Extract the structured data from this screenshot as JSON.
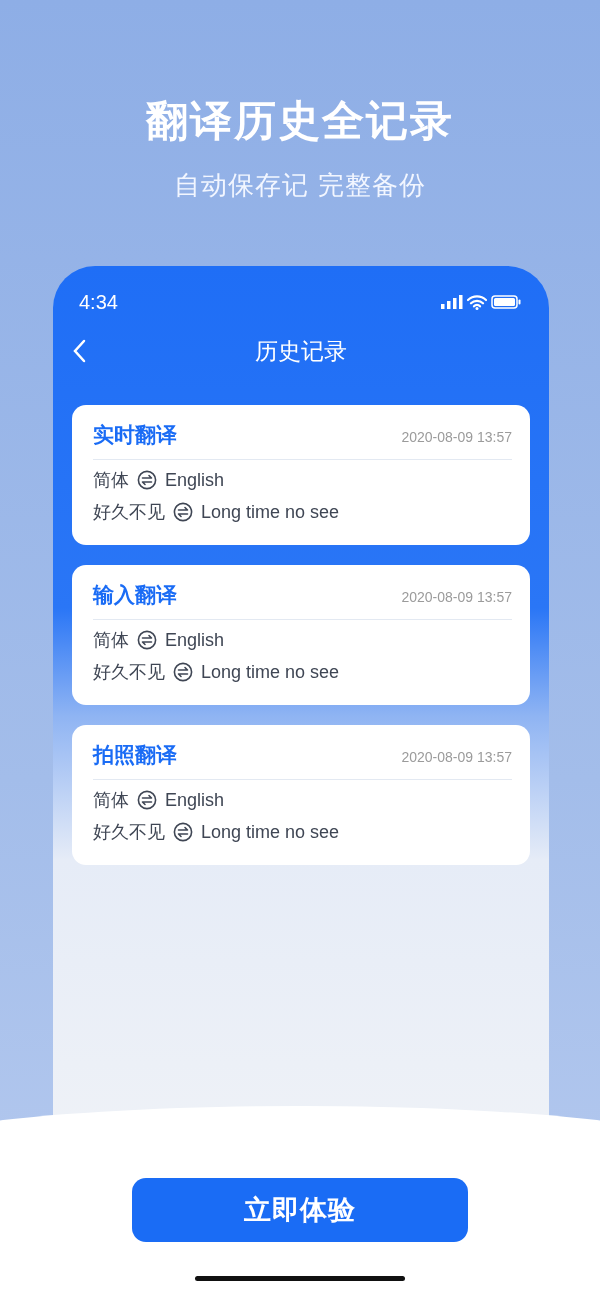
{
  "header": {
    "title": "翻译历史全记录",
    "subtitle": "自动保存记 完整备份"
  },
  "phone": {
    "status_bar": {
      "time": "4:34"
    },
    "nav": {
      "title": "历史记录"
    },
    "records": [
      {
        "type": "实时翻译",
        "date": "2020-08-09 13:57",
        "languages": {
          "source": "简体",
          "target": "English"
        },
        "text": {
          "source": "好久不见",
          "target": "Long time no see"
        }
      },
      {
        "type": "输入翻译",
        "date": "2020-08-09 13:57",
        "languages": {
          "source": "简体",
          "target": "English"
        },
        "text": {
          "source": "好久不见",
          "target": "Long time no see"
        }
      },
      {
        "type": "拍照翻译",
        "date": "2020-08-09 13:57",
        "languages": {
          "source": "简体",
          "target": "English"
        },
        "text": {
          "source": "好久不见",
          "target": "Long time no see"
        }
      }
    ]
  },
  "cta_button": "立即体验"
}
